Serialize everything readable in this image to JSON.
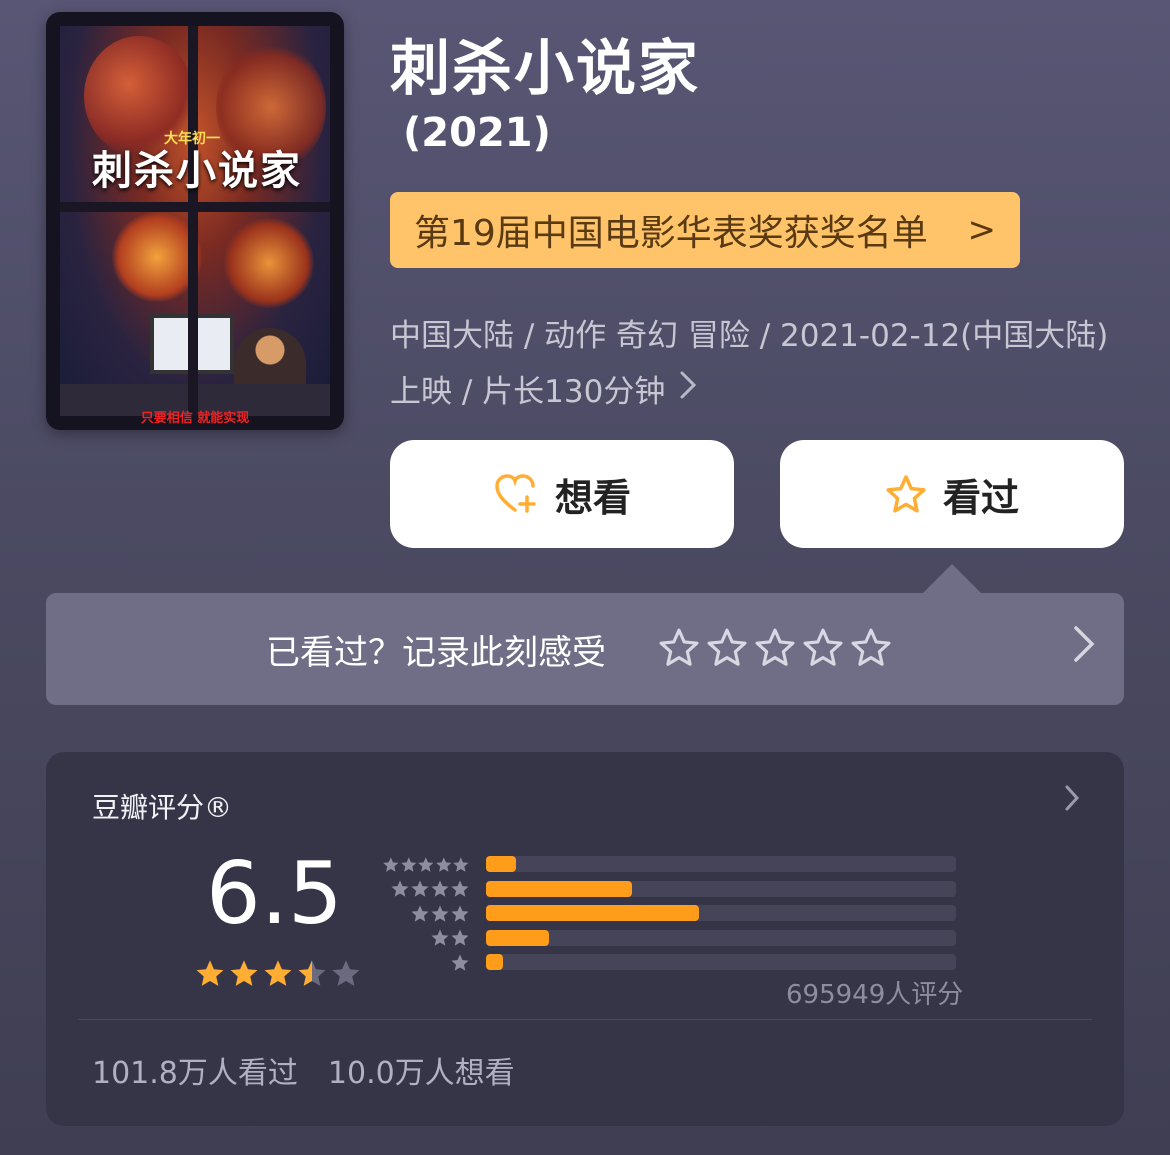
{
  "movie": {
    "title": "刺杀小说家",
    "year": "(2021)",
    "poster": {
      "headline": "刺杀小说家",
      "tag": "大年初一",
      "bottom_text": "只要相信  就能实现"
    }
  },
  "award_banner": {
    "label": "第19届中国电影华表奖获奖名单",
    "chevron": ">"
  },
  "meta": {
    "line1": "中国大陆 / 动作 奇幻 冒险 / 2021-02-12(中国大陆)",
    "line2": "上映 / 片长130分钟"
  },
  "actions": {
    "want_label": "想看",
    "seen_label": "看过"
  },
  "record": {
    "prompt": "已看过？记录此刻感受",
    "empty_star_count": 5
  },
  "rating": {
    "header": "豆瓣评分®",
    "score": "6.5",
    "score_stars": 3.5,
    "distribution_fractions": [
      0.064,
      0.31,
      0.454,
      0.134,
      0.036
    ],
    "count_label": "695949人评分",
    "seen_count": "101.8万人看过",
    "want_count": "10.0万人想看"
  },
  "colors": {
    "accent_orange": "#ff9c19",
    "award_bg": "#ffc46a",
    "star_gold": "#ffad33"
  }
}
